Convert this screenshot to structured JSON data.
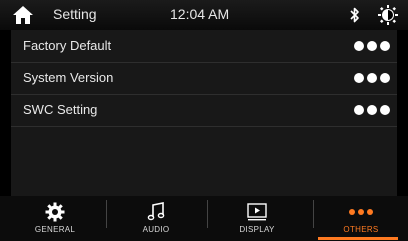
{
  "header": {
    "title": "Setting",
    "clock": "12:04 AM",
    "icons": [
      "home-icon",
      "bluetooth-icon",
      "brightness-icon"
    ]
  },
  "settings": {
    "items": [
      {
        "label": "Factory Default"
      },
      {
        "label": "System Version"
      },
      {
        "label": "SWC Setting"
      }
    ],
    "more_icon": "three-dots-icon"
  },
  "tabs": [
    {
      "label": "GENERAL",
      "icon": "gear-icon",
      "active": false
    },
    {
      "label": "AUDIO",
      "icon": "music-note-icon",
      "active": false
    },
    {
      "label": "DISPLAY",
      "icon": "play-screen-icon",
      "active": false
    },
    {
      "label": "OTHERS",
      "icon": "three-dots-icon",
      "active": true
    }
  ],
  "colors": {
    "accent": "#ff7a21",
    "panel": "#181818",
    "background": "#000000"
  }
}
